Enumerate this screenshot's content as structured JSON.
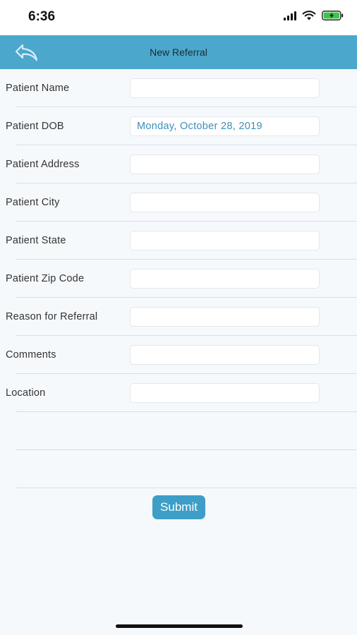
{
  "status_bar": {
    "time": "6:36",
    "icons": [
      "signal-icon",
      "wifi-icon",
      "battery-charging-icon"
    ]
  },
  "nav": {
    "title": "New Referral",
    "back_icon": "back-arrow-icon"
  },
  "form": {
    "fields": [
      {
        "label": "Patient Name",
        "value": ""
      },
      {
        "label": "Patient DOB",
        "value": "Monday, October 28, 2019"
      },
      {
        "label": "Patient Address",
        "value": ""
      },
      {
        "label": "Patient City",
        "value": ""
      },
      {
        "label": "Patient State",
        "value": ""
      },
      {
        "label": "Patient Zip Code",
        "value": ""
      },
      {
        "label": "Reason for Referral",
        "value": ""
      },
      {
        "label": "Comments",
        "value": ""
      },
      {
        "label": "Location",
        "value": ""
      }
    ]
  },
  "submit_label": "Submit",
  "colors": {
    "nav_background": "#4ba7cc",
    "submit_background": "#3d9ec7",
    "date_text": "#3a8fb7",
    "page_background": "#f6f9fc"
  }
}
